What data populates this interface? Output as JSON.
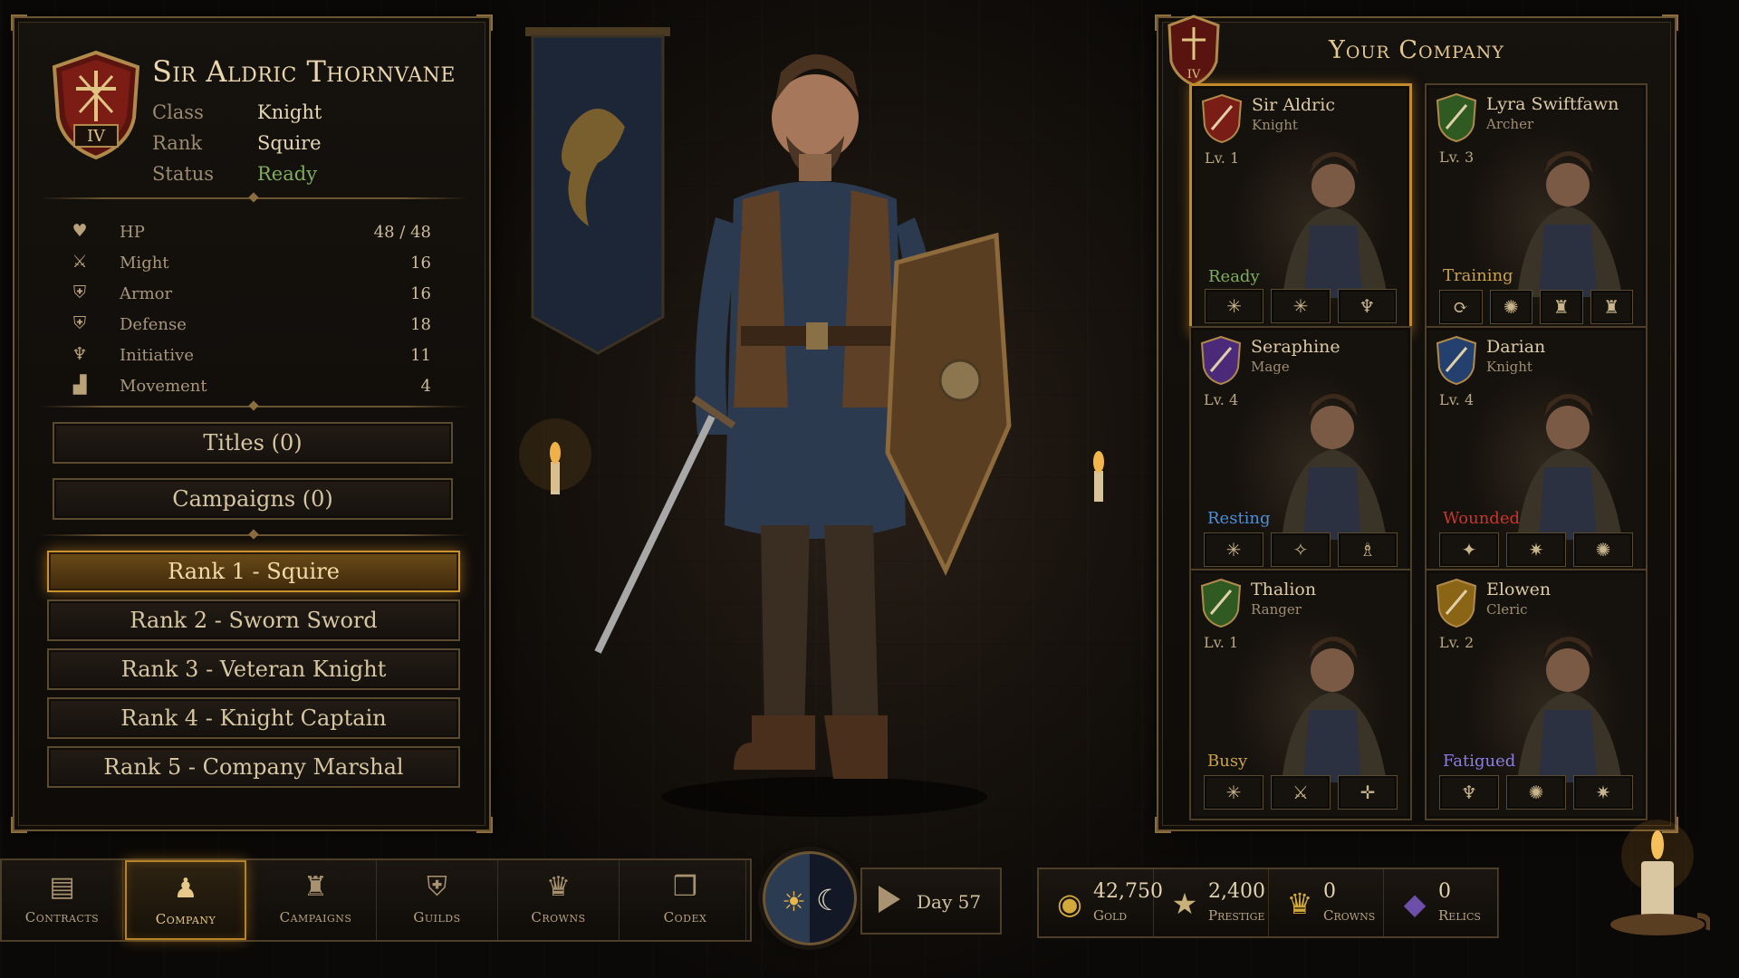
{
  "hero": {
    "name": "Sir Aldric Thornvane",
    "crest_numeral": "IV",
    "class_label": "Class",
    "class_value": "Knight",
    "rank_label": "Rank",
    "rank_value": "Squire",
    "status_label": "Status",
    "status_value": "Ready",
    "status_color": "#7fae5b"
  },
  "stats": [
    {
      "icon": "heart-icon",
      "label": "HP",
      "value": "48 / 48"
    },
    {
      "icon": "sword-icon",
      "label": "Might",
      "value": "16"
    },
    {
      "icon": "shield-icon",
      "label": "Armor",
      "value": "16"
    },
    {
      "icon": "shield-icon",
      "label": "Defense",
      "value": "18"
    },
    {
      "icon": "wing-icon",
      "label": "Initiative",
      "value": "11"
    },
    {
      "icon": "boot-icon",
      "label": "Movement",
      "value": "4"
    }
  ],
  "buttons": {
    "titles": "Titles (0)",
    "campaigns": "Campaigns (0)"
  },
  "ranks": [
    {
      "label": "Rank  1 - Squire",
      "active": true
    },
    {
      "label": "Rank 2 - Sworn Sword",
      "active": false
    },
    {
      "label": "Rank 3 - Veteran Knight",
      "active": false
    },
    {
      "label": "Rank 4 - Knight Captain",
      "active": false
    },
    {
      "label": "Rank 5 - Company Marshal",
      "active": false
    }
  ],
  "company": {
    "title": "Your Company",
    "crest_numeral": "IV",
    "members": [
      {
        "name": "Sir Aldric",
        "class": "Knight",
        "level": "Lv. 1",
        "status": "Ready",
        "status_color": "#7fae5b",
        "badge_color": "#7a1d16",
        "selected": true,
        "skills": [
          "✳",
          "✳",
          "♆"
        ]
      },
      {
        "name": "Lyra Swiftfawn",
        "class": "Archer",
        "level": "Lv. 3",
        "status": "Training",
        "status_color": "#c9a24a",
        "badge_color": "#2f5a22",
        "selected": false,
        "skills": [
          "⟳",
          "✺",
          "♜",
          "♜"
        ]
      },
      {
        "name": "Seraphine",
        "class": "Mage",
        "level": "Lv. 4",
        "status": "Resting",
        "status_color": "#4f8fd6",
        "badge_color": "#4b2a7a",
        "selected": false,
        "skills": [
          "✳",
          "✧",
          "♗"
        ]
      },
      {
        "name": "Darian",
        "class": "Knight",
        "level": "Lv. 4",
        "status": "Wounded",
        "status_color": "#c8362b",
        "badge_color": "#23406e",
        "selected": false,
        "skills": [
          "✦",
          "✷",
          "✺"
        ]
      },
      {
        "name": "Thalion",
        "class": "Ranger",
        "level": "Lv. 1",
        "status": "Busy",
        "status_color": "#c9a24a",
        "badge_color": "#2f5a22",
        "selected": false,
        "skills": [
          "✳",
          "⚔",
          "✛"
        ]
      },
      {
        "name": "Elowen",
        "class": "Cleric",
        "level": "Lv. 2",
        "status": "Fatigued",
        "status_color": "#8c7fe0",
        "badge_color": "#8a6516",
        "selected": false,
        "skills": [
          "♆",
          "✺",
          "✷"
        ]
      }
    ]
  },
  "nav": [
    {
      "label": "Contracts",
      "icon": "contracts-icon",
      "glyph": "▤",
      "active": false
    },
    {
      "label": "Company",
      "icon": "company-icon",
      "glyph": "♟",
      "active": true
    },
    {
      "label": "Campaigns",
      "icon": "campaigns-icon",
      "glyph": "♜",
      "active": false
    },
    {
      "label": "Guilds",
      "icon": "guild-shield-icon",
      "glyph": "⛨",
      "active": false
    },
    {
      "label": "Crowns",
      "icon": "crown-icon",
      "glyph": "♛",
      "active": false
    },
    {
      "label": "Codex",
      "icon": "book-icon",
      "glyph": "❒",
      "active": false
    }
  ],
  "day": {
    "text": "Day 57"
  },
  "resources": [
    {
      "value": "42,750",
      "label": "Gold",
      "icon": "gold-coins-icon",
      "glyph": "◉",
      "color": "#d4a93c"
    },
    {
      "value": "2,400",
      "label": "Prestige",
      "icon": "star-icon",
      "glyph": "★",
      "color": "#c9b27a"
    },
    {
      "value": "0",
      "label": "Crowns",
      "icon": "crown-icon",
      "glyph": "♛",
      "color": "#d4a93c"
    },
    {
      "value": "0",
      "label": "Relics",
      "icon": "relic-gem-icon",
      "glyph": "◆",
      "color": "#6b4fa8"
    }
  ]
}
